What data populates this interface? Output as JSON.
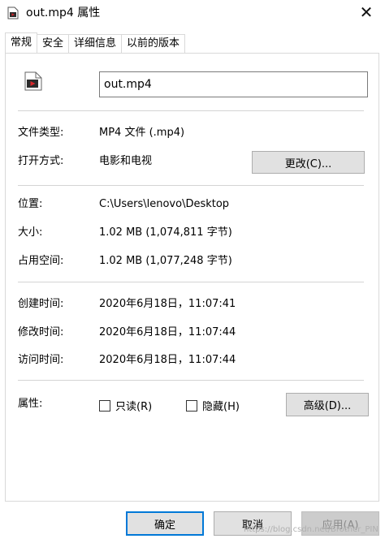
{
  "window": {
    "title": "out.mp4 属性",
    "close_symbol": "✕"
  },
  "tabs": [
    {
      "label": "常规",
      "active": true
    },
    {
      "label": "安全",
      "active": false
    },
    {
      "label": "详细信息",
      "active": false
    },
    {
      "label": "以前的版本",
      "active": false
    }
  ],
  "general": {
    "file_name": "out.mp4",
    "file_type_label": "文件类型:",
    "file_type_value": "MP4 文件 (.mp4)",
    "open_with_label": "打开方式:",
    "open_with_value": "电影和电视",
    "change_button": "更改(C)...",
    "location_label": "位置:",
    "location_value": "C:\\Users\\lenovo\\Desktop",
    "size_label": "大小:",
    "size_value": "1.02 MB (1,074,811 字节)",
    "size_on_disk_label": "占用空间:",
    "size_on_disk_value": "1.02 MB (1,077,248 字节)",
    "created_label": "创建时间:",
    "created_value": "2020年6月18日，11:07:41",
    "modified_label": "修改时间:",
    "modified_value": "2020年6月18日，11:07:44",
    "accessed_label": "访问时间:",
    "accessed_value": "2020年6月18日，11:07:44",
    "attributes_label": "属性:",
    "readonly_label": "只读(R)",
    "hidden_label": "隐藏(H)",
    "advanced_button": "高级(D)..."
  },
  "footer": {
    "ok": "确定",
    "cancel": "取消",
    "apply": "应用(A)",
    "watermark": "https://blog.csdn.net/Brother_PIN"
  },
  "colors": {
    "accent": "#0078d7",
    "icon_red": "#d9252a"
  }
}
